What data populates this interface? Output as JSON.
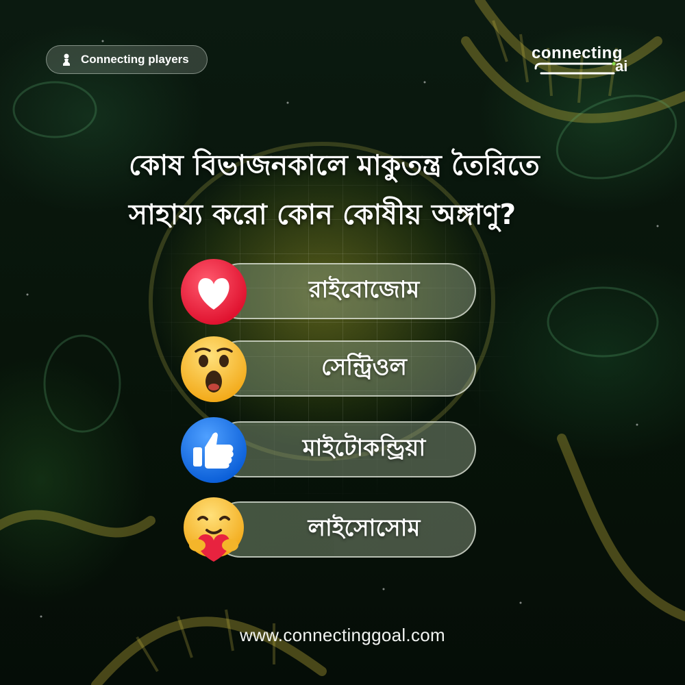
{
  "badge": {
    "label": "Connecting players",
    "icon": "chess-pawn-icon"
  },
  "logo": {
    "top": "connecting",
    "bottom": "ai"
  },
  "question": {
    "line1": "কোষ বিভাজনকালে মাকুতন্ত্র তৈরিতে",
    "line2": "সাহায্য করো কোন কোষীয় অঙ্গাণু?"
  },
  "options": [
    {
      "label": "রাইবোজোম",
      "icon": "heart-reaction-icon"
    },
    {
      "label": "সেন্ট্রিওল",
      "icon": "wow-reaction-icon"
    },
    {
      "label": "মাইটোকন্ড্রিয়া",
      "icon": "like-reaction-icon"
    },
    {
      "label": "লাইসোসোম",
      "icon": "care-reaction-icon"
    }
  ],
  "footer": {
    "url": "www.connectinggoal.com"
  },
  "colors": {
    "heart": "#f0284a",
    "wow": "#f7c531",
    "like": "#1877f2",
    "care": "#f7c531",
    "accent_green": "#8be04e"
  }
}
